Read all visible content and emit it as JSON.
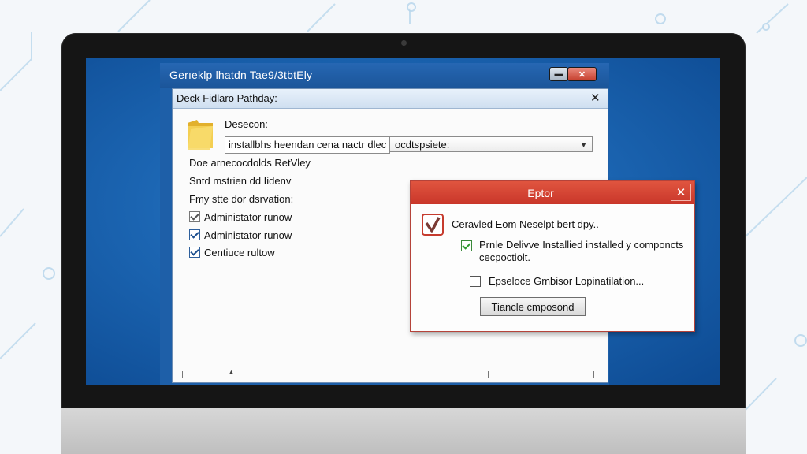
{
  "window": {
    "title": "Gerıeklp lhatdn Tae9/3tbtEly",
    "minimize_label": "▬",
    "close_label": "✕"
  },
  "dialog": {
    "title": "Deck Fidlaro Pathday:",
    "close_label": "✕",
    "description_label": "Desecon:",
    "path_value": "installbhs heendan cena nactr dlec",
    "select_value": "ocdtspsiete:",
    "select_caret": "▼",
    "line1": "Doe arnecocdolds RetVley",
    "line2": "Sntd mstrien dd Iidenv",
    "line3": "Fmy stte dor dsrvation:",
    "checkboxes": [
      {
        "label": "Administator runow",
        "checked": true
      },
      {
        "label": "Administator runow",
        "checked": true
      },
      {
        "label": "Centiuce rultow",
        "checked": true
      }
    ],
    "caret_mark": "▲"
  },
  "error_dialog": {
    "title": "Eptor",
    "close_label": "✕",
    "message": "Ceravled Eom Neselpt bert dpy..",
    "checkbox1_label": "Prnle Delivve Installied installed y componcts cecpoctiolt.",
    "checkbox2_label": "Epseloce Gmbisor Lopinatilation...",
    "button_label": "Tiancle cmposond"
  }
}
